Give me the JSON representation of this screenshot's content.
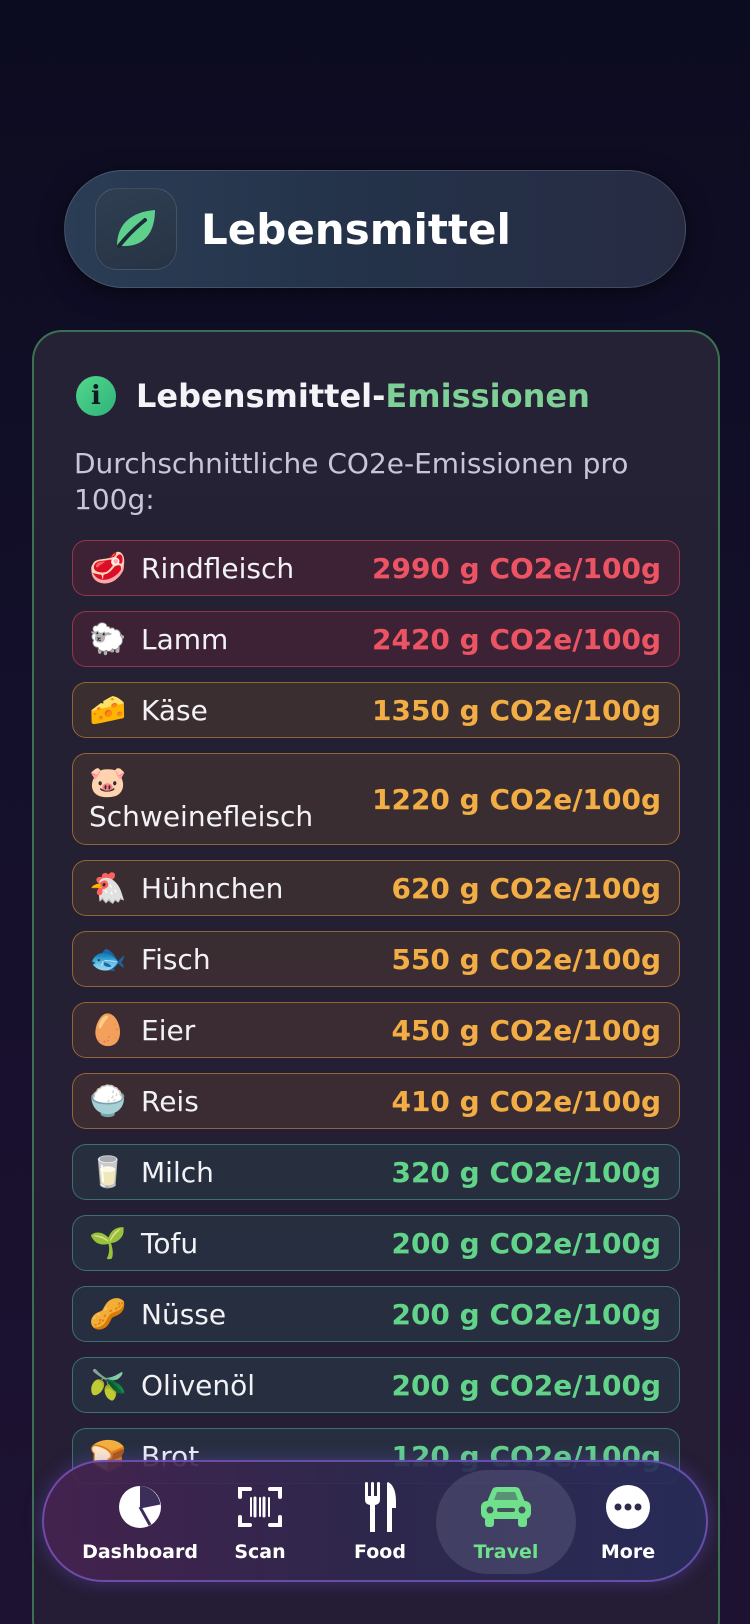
{
  "header": {
    "title": "Lebensmittel",
    "icon": "leaf-icon"
  },
  "info_card": {
    "title_part1": "Lebensmittel-",
    "title_part2": "Emissionen",
    "subtitle": "Durchschnittliche CO2e-Emissionen pro 100g:",
    "items": [
      {
        "emoji": "🥩",
        "name": "Rindfleisch",
        "value": "2990 g CO2e/100g",
        "level": "red"
      },
      {
        "emoji": "🐑",
        "name": "Lamm",
        "value": "2420 g CO2e/100g",
        "level": "red"
      },
      {
        "emoji": "🧀",
        "name": "Käse",
        "value": "1350 g CO2e/100g",
        "level": "orange"
      },
      {
        "emoji": "🐷",
        "name": "Schweinefleisch",
        "value": "1220 g CO2e/100g",
        "level": "orange"
      },
      {
        "emoji": "🐔",
        "name": "Hühnchen",
        "value": "620 g CO2e/100g",
        "level": "orange"
      },
      {
        "emoji": "🐟",
        "name": "Fisch",
        "value": "550 g CO2e/100g",
        "level": "orange"
      },
      {
        "emoji": "🥚",
        "name": "Eier",
        "value": "450 g CO2e/100g",
        "level": "orange"
      },
      {
        "emoji": "🍚",
        "name": "Reis",
        "value": "410 g CO2e/100g",
        "level": "orange"
      },
      {
        "emoji": "🥛",
        "name": "Milch",
        "value": "320 g CO2e/100g",
        "level": "green"
      },
      {
        "emoji": "🌱",
        "name": "Tofu",
        "value": "200 g CO2e/100g",
        "level": "green"
      },
      {
        "emoji": "🥜",
        "name": "Nüsse",
        "value": "200 g CO2e/100g",
        "level": "green"
      },
      {
        "emoji": "🫒",
        "name": "Olivenöl",
        "value": "200 g CO2e/100g",
        "level": "green"
      },
      {
        "emoji": "🍞",
        "name": "Brot",
        "value": "120 g CO2e/100g",
        "level": "green"
      }
    ]
  },
  "nav": {
    "items": [
      {
        "label": "Dashboard",
        "icon": "pie-chart-icon"
      },
      {
        "label": "Scan",
        "icon": "barcode-scan-icon"
      },
      {
        "label": "Food",
        "icon": "fork-knife-icon"
      },
      {
        "label": "Travel",
        "icon": "car-icon",
        "active": true
      },
      {
        "label": "More",
        "icon": "more-dots-icon"
      }
    ]
  },
  "colors": {
    "red": "#ec5464",
    "orange": "#f2ae45",
    "green": "#62d48a",
    "nav_active": "#6fe08c"
  }
}
